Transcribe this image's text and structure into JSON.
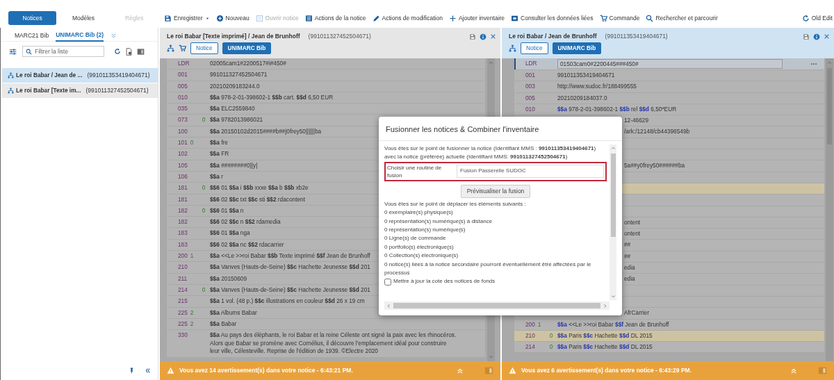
{
  "app_tabs": [
    {
      "label": "Notices",
      "selected": true,
      "disabled": false
    },
    {
      "label": "Modèles",
      "selected": false,
      "disabled": false
    },
    {
      "label": "Règles",
      "selected": false,
      "disabled": true
    }
  ],
  "toolbar": [
    {
      "label": "Enregistrer",
      "disabled": false,
      "dropdown": true
    },
    {
      "label": "Nouveau",
      "disabled": false,
      "dropdown": false
    },
    {
      "label": "Ouvrir notice",
      "disabled": true,
      "dropdown": false
    },
    {
      "label": "Actions de la notice",
      "disabled": false,
      "dropdown": false
    },
    {
      "label": "Actions de modification",
      "disabled": false,
      "dropdown": false
    },
    {
      "label": "Ajouter inventaire",
      "disabled": false,
      "dropdown": false
    },
    {
      "label": "Consulter les données liées",
      "disabled": false,
      "dropdown": false
    },
    {
      "label": "Commande",
      "disabled": false,
      "dropdown": false
    },
    {
      "label": "Rechercher et parcourir",
      "disabled": false,
      "dropdown": false
    }
  ],
  "old_editor": {
    "label": "Old Edit"
  },
  "sidebar": {
    "tabs": [
      {
        "label": "MARC21 Bib",
        "selected": false
      },
      {
        "label": "UNIMARC Bib (2)",
        "selected": true
      }
    ],
    "filter": {
      "placeholder": "Filtrer la liste"
    },
    "items": [
      {
        "title": "Le roi Babar / Jean de ...",
        "id": "(991011353419404671)",
        "selected": true
      },
      {
        "title": "Le roi Babar [Texte im...",
        "id": "(991011327452504671)",
        "selected": false
      }
    ]
  },
  "editors": [
    {
      "title": "Le roi Babar [Texte imprimé] / Jean de Brunhoff",
      "id": "(991011327452504671)",
      "active": false,
      "badges": [
        {
          "label": "Notice",
          "kind": "outline"
        },
        {
          "label": "UNIMARC Bib",
          "kind": "filled"
        }
      ],
      "rows": [
        {
          "kind": "field",
          "tag": "LDR",
          "value": "02005cam1#2200517#i#450#"
        },
        {
          "kind": "field",
          "tag": "001",
          "value": "991011327452504671"
        },
        {
          "kind": "field",
          "tag": "005",
          "value": "20210209183244.0"
        },
        {
          "kind": "field",
          "tag": "010",
          "value": "**$$a** 978-2-01-398602-1 **$$b** cart. **$$d** 6,50 EUR"
        },
        {
          "kind": "field",
          "tag": "035",
          "value": "**$$a** ELC2559840"
        },
        {
          "kind": "field",
          "tag": "073",
          "ind2": "0",
          "value": "**$$a** 9782013986021"
        },
        {
          "kind": "field",
          "tag": "100",
          "value": "**$$a** 20150102d2015####b##j0frey50||||||ba"
        },
        {
          "kind": "field",
          "tag": "101",
          "ind1": "0",
          "value": "**$$a** fre"
        },
        {
          "kind": "field",
          "tag": "102",
          "value": "**$$a** FR"
        },
        {
          "kind": "field",
          "tag": "105",
          "value": "**$$a** ########0||y|"
        },
        {
          "kind": "field",
          "tag": "106",
          "value": "**$$a** r"
        },
        {
          "kind": "field",
          "tag": "181",
          "ind2": "0",
          "value": "**$$6** 01 **$$a** i **$$b** xxxe **$$a** b **$$b** xb2e"
        },
        {
          "kind": "field",
          "tag": "181",
          "value": "**$$6** 02 **$$c** txt **$$c** sti **$$2** rdacontent"
        },
        {
          "kind": "field",
          "tag": "182",
          "ind2": "0",
          "value": "**$$6** 01 **$$a** n"
        },
        {
          "kind": "field",
          "tag": "182",
          "value": "**$$6** 02 **$$c** n **$$2** rdamedia"
        },
        {
          "kind": "field",
          "tag": "183",
          "value": "**$$6** 01 **$$a** nga"
        },
        {
          "kind": "field",
          "tag": "183",
          "value": "**$$6** 02 **$$a** nc **$$2** rdacarrier"
        },
        {
          "kind": "field",
          "tag": "200",
          "ind1": "1",
          "value": "**$$a** <<Le >>roi Babar **$$b** Texte imprimé **$$f** Jean de Brunhoff"
        },
        {
          "kind": "field",
          "tag": "210",
          "value": "**$$a** Vanves (Hauts-de-Seine) **$$c** Hachette Jeunesse **$$d** 201"
        },
        {
          "kind": "field",
          "tag": "211",
          "value": "**$$a** 20150609"
        },
        {
          "kind": "field",
          "tag": "214",
          "ind2": "0",
          "value": "**$$a** Vanves (Hauts-de-Seine) **$$c** Hachette Jeunesse **$$d** 201"
        },
        {
          "kind": "field",
          "tag": "215",
          "value": "**$$a** 1 vol. (48 p.) **$$c** illustrations en couleur **$$d** 26 x 19 cm"
        },
        {
          "kind": "field",
          "tag": "225",
          "ind1": "2",
          "value": "**$$a** Albums Babar"
        },
        {
          "kind": "field",
          "tag": "225",
          "ind1": "2",
          "value": "**$$a** Babar"
        },
        {
          "kind": "field",
          "tag": "330",
          "value": "**$$a** Au pays des éléphants, le roi Babar et la reine Céleste ont signé la paix avec les rhinocéros. Alors que Babar se promène avec Cornélius, il découvre l'emplacement idéal pour construire leur ville, Célesteville. Reprise de l'édition de 1939. ©Electre 2020"
        }
      ],
      "warning": "Vous avez 14 avertissement(s) dans votre notice - 6:43:21 PM."
    },
    {
      "title": "Le roi Babar / Jean de Brunhoff",
      "id": "(991011353419404671)",
      "active": true,
      "badges": [
        {
          "label": "Notice",
          "kind": "outline"
        },
        {
          "label": "UNIMARC Bib",
          "kind": "filled"
        }
      ],
      "rows": [
        {
          "kind": "editing",
          "tag": "LDR",
          "value": "01503cam0#2200445###450#"
        },
        {
          "kind": "field",
          "tag": "001",
          "value": "991011353419404671",
          "highlighted": false
        },
        {
          "kind": "field",
          "tag": "003",
          "value": "http://www.sudoc.fr/188499555",
          "highlighted": false
        },
        {
          "kind": "field",
          "tag": "005",
          "value": "20210209184037.0",
          "highlighted": false
        },
        {
          "kind": "field",
          "tag": "010",
          "value": "**$$a** 978-2-01-398602-1 **$$b** rel **$$d** 6,50*EUR",
          "highlighted": false
        },
        {
          "kind": "covered",
          "value": "12-46629",
          "highlighted": false
        },
        {
          "kind": "covered",
          "value": "/ark:/12148/cb44396549b",
          "highlighted": false
        },
        {
          "kind": "covered",
          "highlighted": false
        },
        {
          "kind": "covered",
          "highlighted": false
        },
        {
          "kind": "covered",
          "value": "5a##y0frey50######ba",
          "highlighted": false
        },
        {
          "kind": "covered",
          "highlighted": false
        },
        {
          "kind": "covered",
          "highlighted": true
        },
        {
          "kind": "covered",
          "highlighted": false
        },
        {
          "kind": "covered",
          "highlighted": false
        },
        {
          "kind": "covered",
          "value": "ontent",
          "highlighted": false
        },
        {
          "kind": "covered",
          "value": "ontent",
          "highlighted": false
        },
        {
          "kind": "covered",
          "value": "##",
          "highlighted": false
        },
        {
          "kind": "covered",
          "value": "##",
          "highlighted": false
        },
        {
          "kind": "covered",
          "value": "edia",
          "highlighted": false
        },
        {
          "kind": "covered",
          "value": "edia",
          "highlighted": false
        },
        {
          "kind": "covered",
          "highlighted": false
        },
        {
          "kind": "covered",
          "highlighted": false
        },
        {
          "kind": "covered",
          "value": "AfrCarrier",
          "highlighted": false
        },
        {
          "kind": "field",
          "tag": "200",
          "ind1": "1",
          "value": "**$$a** <<Le >>roi Babar **$$f** Jean de Brunhoff",
          "highlighted": false
        },
        {
          "kind": "field",
          "tag": "210",
          "ind2": "0",
          "value": "**$$a** Paris **$$c** Hachette **$$d** DL 2015",
          "highlighted": true
        },
        {
          "kind": "field",
          "tag": "214",
          "ind2": "0",
          "value": "**$$a** Paris **$$c** Hachette **$$d** DL 2015",
          "highlighted": false
        }
      ],
      "warning": "Vous avez 6 avertissement(s) dans votre notice - 6:43:29 PM."
    }
  ],
  "dialog": {
    "title": "Fusionner les notices & Combiner l'inventaire",
    "intro": "Vous êtes sur le point de fusionner la notice (Identifiant MMS : **991011353419404671**) avec la notice (préférée) actuelle (Identifiant MMS: **991011327452504671**)",
    "routine": {
      "label": "Choisir une routine de fusion",
      "value": "Fusion Passerelle SUDOC"
    },
    "preview_button": "Prévisualiser la fusion",
    "move_heading": "Vous êtes sur le point de déplacer les éléments suivants :",
    "move_items": [
      "0 exemplaire(s) physique(s)",
      "0 représentation(s) numérique(s) à distance",
      "0 représentation(s) numérique(s)",
      "0 Ligne(s) de commande",
      "0 portfolio(s) électronique(s)",
      "0 Collection(s) électronique(s)",
      "0 notice(s) liées à la notice secondaire pourront éventuellement être affectées par le processus"
    ],
    "update_checkbox": {
      "label": "Mettre à jour la cote des notices de fonds",
      "checked": false
    }
  }
}
